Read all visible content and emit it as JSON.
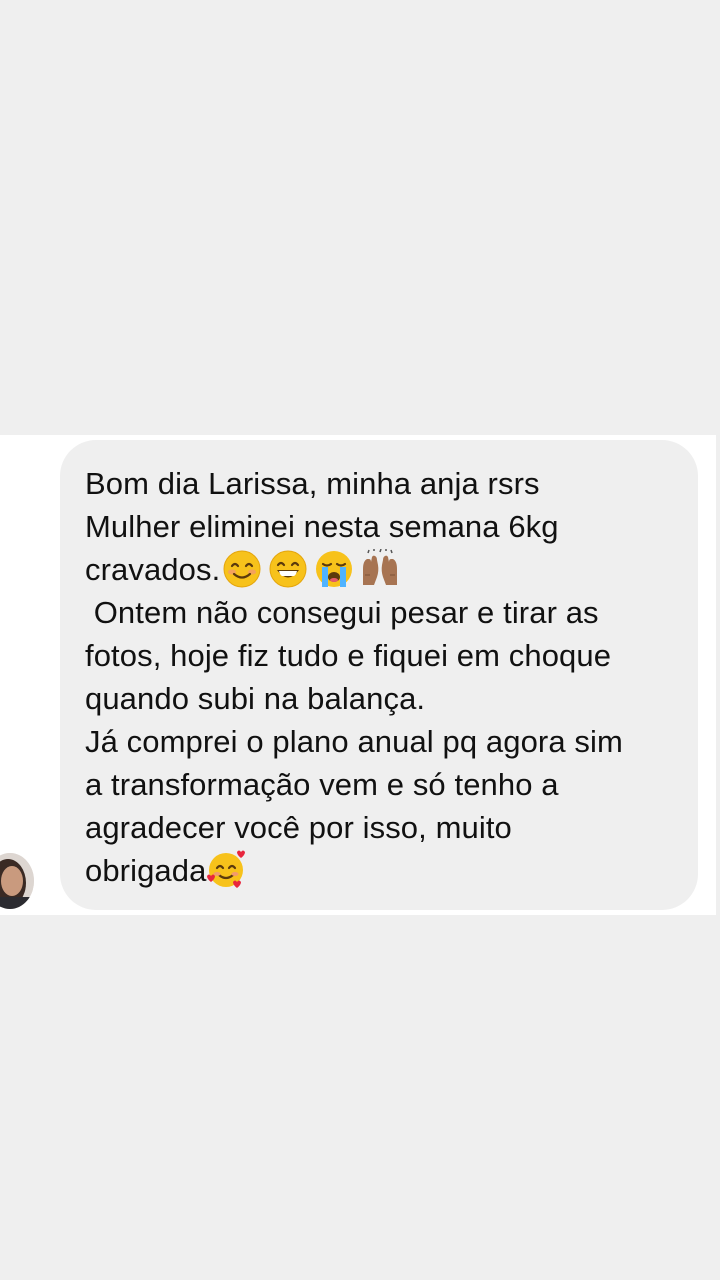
{
  "message": {
    "paragraphs": [
      {
        "lines": [
          "Bom dia Larissa, minha anja rsrs"
        ]
      },
      {
        "lines": [
          "Mulher eliminei nesta semana 6kg",
          "cravados."
        ]
      },
      {
        "lines": [
          " Ontem não consegui pesar e tirar as",
          "fotos, hoje fiz tudo e fiquei em choque",
          "quando subi na balança."
        ]
      },
      {
        "lines": [
          "Já comprei o plano anual pq agora sim",
          "a transformação vem e só tenho a",
          "agradecer você por isso, muito",
          "obrigada"
        ]
      }
    ],
    "emojis_after_cravados": [
      "smiling-face-icon",
      "grinning-face-icon",
      "loudly-crying-face-icon",
      "raising-hands-icon"
    ],
    "emoji_after_obrigada": "smiling-face-with-hearts-icon"
  },
  "sender": {
    "avatar_icon": "avatar"
  },
  "colors": {
    "page_background": "#efefef",
    "chat_background": "#ffffff",
    "bubble_background": "#efefef",
    "text": "#111111"
  }
}
